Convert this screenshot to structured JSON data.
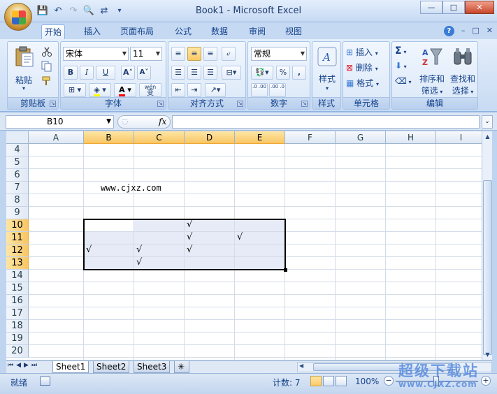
{
  "window": {
    "title": "Book1 - Microsoft Excel",
    "minimize": "—",
    "restore": "□",
    "close": "✕"
  },
  "qat": {
    "save": "💾",
    "undo": "↶",
    "redo": "↷",
    "preview": "🔍",
    "print": "⇄",
    "more": "▾"
  },
  "tabs": [
    "开始",
    "插入",
    "页面布局",
    "公式",
    "数据",
    "审阅",
    "视图"
  ],
  "active_tab": "开始",
  "ribbon_right": {
    "minimize": "–",
    "restore": "□",
    "close": "✕",
    "help": "?"
  },
  "groups": {
    "clipboard": {
      "label": "剪贴板",
      "paste": "粘贴",
      "cut_icon": "scissors-icon",
      "copy_icon": "copy-icon",
      "format_painter_icon": "brush-icon"
    },
    "font": {
      "label": "字体",
      "font_name": "宋体",
      "font_size": "11",
      "bold": "B",
      "italic": "I",
      "underline": "U",
      "grow": "A˄",
      "shrink": "A˅",
      "phonetic_top": "wén",
      "phonetic_bottom": "变"
    },
    "alignment": {
      "label": "对齐方式"
    },
    "number": {
      "label": "数字",
      "format": "常规",
      "percent": "%",
      "comma": ",",
      "inc_decimal": ".0 .00",
      "dec_decimal": ".00 .0"
    },
    "styles": {
      "label": "样式",
      "button": "样式"
    },
    "cells": {
      "label": "单元格",
      "insert": "插入",
      "delete": "删除",
      "format": "格式"
    },
    "editing": {
      "label": "编辑",
      "sum": "Σ",
      "sort_filter_1": "排序和",
      "sort_filter_2": "筛选",
      "find_select_1": "查找和",
      "find_select_2": "选择"
    }
  },
  "formula_bar": {
    "name_box": "B10",
    "fx": "fx",
    "value": ""
  },
  "columns": [
    "A",
    "B",
    "C",
    "D",
    "E",
    "F",
    "G",
    "H",
    "I"
  ],
  "rows": [
    "4",
    "5",
    "6",
    "7",
    "8",
    "9",
    "10",
    "11",
    "12",
    "13",
    "14",
    "15",
    "16",
    "17",
    "18",
    "19",
    "20"
  ],
  "highlight_columns": [
    "B",
    "C",
    "D",
    "E"
  ],
  "highlight_rows": [
    "10",
    "11",
    "12",
    "13"
  ],
  "cells": [
    {
      "ref": "B7",
      "text": "www.cjxz.com"
    }
  ],
  "checks": [
    {
      "ref": "D10",
      "text": "√"
    },
    {
      "ref": "D11",
      "text": "√"
    },
    {
      "ref": "E11",
      "text": "√"
    },
    {
      "ref": "B12",
      "text": "√"
    },
    {
      "ref": "C12",
      "text": "√"
    },
    {
      "ref": "D12",
      "text": "√"
    },
    {
      "ref": "C13",
      "text": "√"
    }
  ],
  "sheets": [
    "Sheet1",
    "Sheet2",
    "Sheet3"
  ],
  "active_sheet": "Sheet1",
  "status": {
    "ready": "就绪",
    "count": "计数: 7",
    "zoom": "100%",
    "zoom_minus": "−",
    "zoom_plus": "+"
  },
  "watermark": {
    "title": "超级下载站",
    "url": "www.CJXZ.com"
  },
  "colors": {
    "accent": "#15428b",
    "ribbon": "#dbe8f8",
    "selection": "#e6ebf7",
    "header_highlight": "#f8c665"
  }
}
